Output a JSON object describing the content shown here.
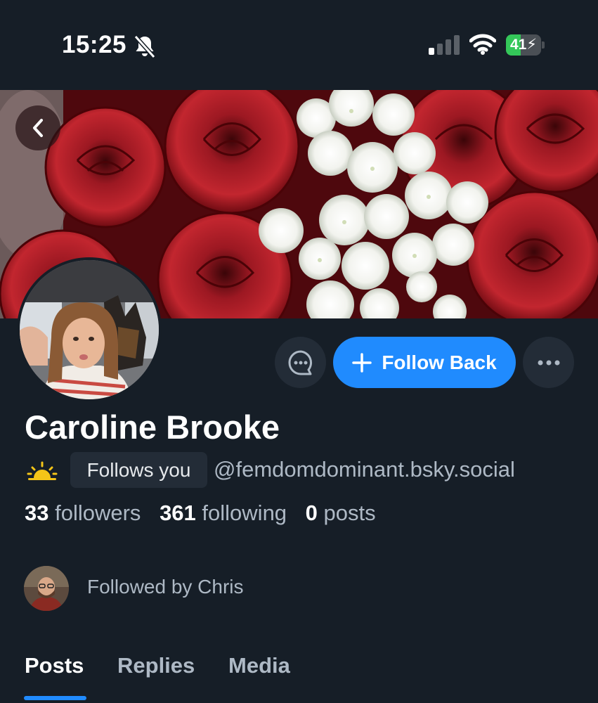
{
  "status_bar": {
    "time": "15:25",
    "battery_level": "41",
    "battery_fraction": 0.41,
    "icons": [
      "bell-slash-icon",
      "cellular-signal-icon",
      "wifi-icon",
      "battery-charging-icon"
    ]
  },
  "profile": {
    "display_name": "Caroline Brooke",
    "handle": "@femdomdominant.bsky.social",
    "follows_you_label": "Follows you",
    "follow_back_label": "Follow Back",
    "stats": {
      "followers_count": "33",
      "followers_label": "followers",
      "following_count": "361",
      "following_label": "following",
      "posts_count": "0",
      "posts_label": "posts"
    },
    "followed_by": "Followed by Chris"
  },
  "tabs": [
    {
      "label": "Posts",
      "active": true
    },
    {
      "label": "Replies",
      "active": false
    },
    {
      "label": "Media",
      "active": false
    }
  ],
  "colors": {
    "background": "#161e27",
    "accent": "#208bfe",
    "muted_text": "#aeb9c5",
    "button_bg": "#232c37",
    "battery_green": "#34c759"
  }
}
